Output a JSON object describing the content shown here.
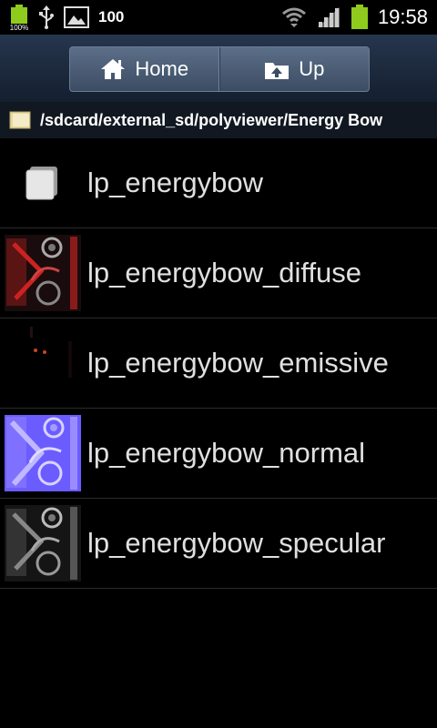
{
  "status_bar": {
    "battery_small_label": "100%",
    "notification_text": "100",
    "time": "19:58"
  },
  "toolbar": {
    "home_label": "Home",
    "up_label": "Up"
  },
  "path": "/sdcard/external_sd/polyviewer/Energy Bow",
  "files": [
    {
      "name": "lp_energybow",
      "icon": "model-file-icon"
    },
    {
      "name": "lp_energybow_diffuse",
      "icon": "diffuse-texture-thumbnail"
    },
    {
      "name": "lp_energybow_emissive",
      "icon": "emissive-texture-thumbnail"
    },
    {
      "name": "lp_energybow_normal",
      "icon": "normal-map-thumbnail"
    },
    {
      "name": "lp_energybow_specular",
      "icon": "specular-texture-thumbnail"
    }
  ],
  "colors": {
    "accent_green": "#8ecb1d",
    "toolbar_bg": "#26364d",
    "pathbar_bg": "#121821",
    "normal_map": "#6b5cff",
    "diffuse": "#9b1b1b"
  }
}
